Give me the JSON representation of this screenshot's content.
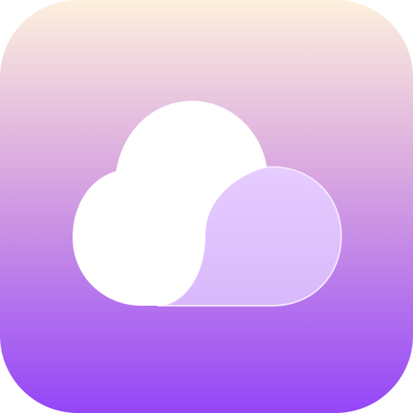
{
  "app_icon": {
    "icon": "weather-cloud-icon",
    "colors": {
      "gradient_top": "#FDF0DD",
      "gradient_mid": "#D9A7E0",
      "gradient_bottom": "#9446F8",
      "cloud_front": "#FFFFFF",
      "cloud_back_top": "#E6CCFF",
      "cloud_back_bottom": "#D8B8FA",
      "cloud_back_stroke": "#F3E6FF"
    }
  }
}
